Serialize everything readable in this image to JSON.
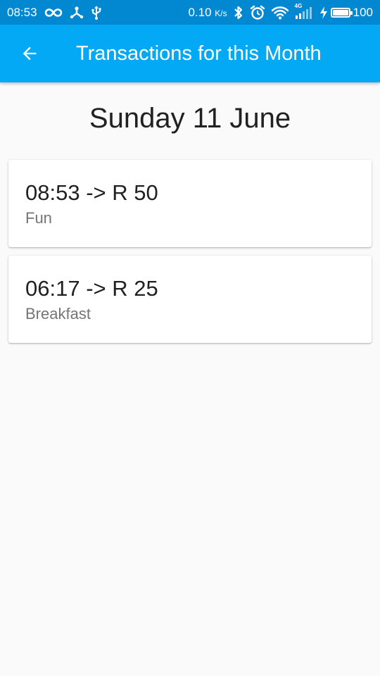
{
  "status_bar": {
    "time": "08:53",
    "speed_value": "0.10",
    "speed_unit": "K/s",
    "network_label": "4G",
    "battery_level": "100",
    "battery_fraction": 1.0,
    "icons": [
      "infinity-icon",
      "usb-tree-icon",
      "usb-icon",
      "bluetooth-icon",
      "alarm-icon",
      "wifi-icon",
      "signal-icon",
      "charging-bolt-icon",
      "battery-icon"
    ]
  },
  "app_bar": {
    "title": "Transactions for this Month",
    "back_icon": "arrow-back-icon"
  },
  "colors": {
    "status_bar": "#0288d1",
    "app_bar": "#03a9f4",
    "background": "#fafafa",
    "card": "#ffffff",
    "primary_text": "#212121",
    "secondary_text": "#757575"
  },
  "date_heading": "Sunday 11 June",
  "transactions": [
    {
      "amount_text": "08:53 -> R 50",
      "category": "Fun"
    },
    {
      "amount_text": "06:17 -> R 25",
      "category": "Breakfast"
    }
  ]
}
